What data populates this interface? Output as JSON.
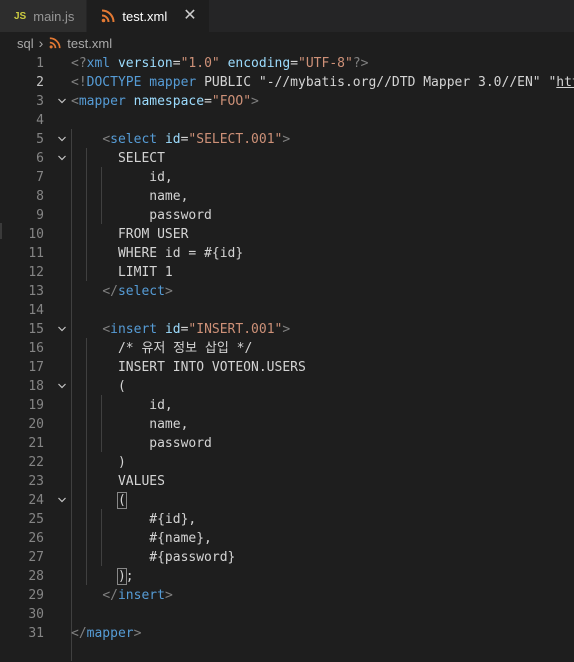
{
  "tabs": [
    {
      "label": "main.js",
      "icon": "js-icon",
      "badge": "JS",
      "active": false
    },
    {
      "label": "test.xml",
      "icon": "rss-icon",
      "active": true,
      "close": "✕"
    }
  ],
  "breadcrumb": {
    "folder": "sql",
    "separator": "›",
    "file": "test.xml"
  },
  "editor": {
    "lines": [
      {
        "n": "1",
        "tokens": [
          [
            "punct",
            "<?"
          ],
          [
            "tag",
            "xml"
          ],
          [
            "text",
            " "
          ],
          [
            "attr",
            "version"
          ],
          [
            "text",
            "="
          ],
          [
            "str",
            "\"1.0\""
          ],
          [
            "text",
            " "
          ],
          [
            "attr",
            "encoding"
          ],
          [
            "text",
            "="
          ],
          [
            "str",
            "\"UTF-8\""
          ],
          [
            "punct",
            "?>"
          ]
        ]
      },
      {
        "n": "2",
        "tokens": [
          [
            "punct",
            "<!"
          ],
          [
            "tag",
            "DOCTYPE"
          ],
          [
            "text",
            " "
          ],
          [
            "tag",
            "mapper"
          ],
          [
            "text",
            " PUBLIC "
          ],
          [
            "text",
            "\"-//mybatis.org//DTD Mapper 3.0//EN\""
          ],
          [
            "text",
            " \""
          ],
          [
            "url",
            "http"
          ]
        ]
      },
      {
        "n": "3",
        "tokens": [
          [
            "punct",
            "<"
          ],
          [
            "tag",
            "mapper"
          ],
          [
            "text",
            " "
          ],
          [
            "attr",
            "namespace"
          ],
          [
            "text",
            "="
          ],
          [
            "str",
            "\"FOO\""
          ],
          [
            "punct",
            ">"
          ]
        ]
      },
      {
        "n": "4",
        "tokens": []
      },
      {
        "n": "5",
        "tokens": [
          [
            "text",
            "    "
          ],
          [
            "punct",
            "<"
          ],
          [
            "tag",
            "select"
          ],
          [
            "text",
            " "
          ],
          [
            "attr",
            "id"
          ],
          [
            "text",
            "="
          ],
          [
            "str",
            "\"SELECT.001\""
          ],
          [
            "punct",
            ">"
          ]
        ]
      },
      {
        "n": "6",
        "tokens": [
          [
            "text",
            "      SELECT"
          ]
        ]
      },
      {
        "n": "7",
        "tokens": [
          [
            "text",
            "          id,"
          ]
        ]
      },
      {
        "n": "8",
        "tokens": [
          [
            "text",
            "          name,"
          ]
        ]
      },
      {
        "n": "9",
        "tokens": [
          [
            "text",
            "          password"
          ]
        ]
      },
      {
        "n": "10",
        "tokens": [
          [
            "text",
            "      FROM USER"
          ]
        ]
      },
      {
        "n": "11",
        "tokens": [
          [
            "text",
            "      WHERE id = #{id}"
          ]
        ]
      },
      {
        "n": "12",
        "tokens": [
          [
            "text",
            "      LIMIT 1"
          ]
        ]
      },
      {
        "n": "13",
        "tokens": [
          [
            "text",
            "    "
          ],
          [
            "punct",
            "</"
          ],
          [
            "tag",
            "select"
          ],
          [
            "punct",
            ">"
          ]
        ]
      },
      {
        "n": "14",
        "tokens": []
      },
      {
        "n": "15",
        "tokens": [
          [
            "text",
            "    "
          ],
          [
            "punct",
            "<"
          ],
          [
            "tag",
            "insert"
          ],
          [
            "text",
            " "
          ],
          [
            "attr",
            "id"
          ],
          [
            "text",
            "="
          ],
          [
            "str",
            "\"INSERT.001\""
          ],
          [
            "punct",
            ">"
          ]
        ]
      },
      {
        "n": "16",
        "tokens": [
          [
            "text",
            "      /* 유저 정보 삽입 */"
          ]
        ]
      },
      {
        "n": "17",
        "tokens": [
          [
            "text",
            "      INSERT INTO VOTEON.USERS"
          ]
        ]
      },
      {
        "n": "18",
        "tokens": [
          [
            "text",
            "      ("
          ]
        ]
      },
      {
        "n": "19",
        "tokens": [
          [
            "text",
            "          id,"
          ]
        ]
      },
      {
        "n": "20",
        "tokens": [
          [
            "text",
            "          name,"
          ]
        ]
      },
      {
        "n": "21",
        "tokens": [
          [
            "text",
            "          password"
          ]
        ]
      },
      {
        "n": "22",
        "tokens": [
          [
            "text",
            "      )"
          ]
        ]
      },
      {
        "n": "23",
        "tokens": [
          [
            "text",
            "      VALUES"
          ]
        ]
      },
      {
        "n": "24",
        "tokens": [
          [
            "text",
            "      "
          ],
          [
            "box",
            "("
          ]
        ]
      },
      {
        "n": "25",
        "tokens": [
          [
            "text",
            "          #{id},"
          ]
        ]
      },
      {
        "n": "26",
        "tokens": [
          [
            "text",
            "          #{name},"
          ]
        ]
      },
      {
        "n": "27",
        "tokens": [
          [
            "text",
            "          #{password}"
          ]
        ]
      },
      {
        "n": "28",
        "tokens": [
          [
            "text",
            "      "
          ],
          [
            "box",
            ")"
          ],
          [
            "text",
            ";"
          ]
        ]
      },
      {
        "n": "29",
        "tokens": [
          [
            "text",
            "    "
          ],
          [
            "punct",
            "</"
          ],
          [
            "tag",
            "insert"
          ],
          [
            "punct",
            ">"
          ]
        ]
      },
      {
        "n": "30",
        "tokens": []
      },
      {
        "n": "31",
        "tokens": [
          [
            "punct",
            "</"
          ],
          [
            "tag",
            "mapper"
          ],
          [
            "punct",
            ">"
          ]
        ]
      }
    ],
    "fold_lines": [
      "3",
      "5",
      "6",
      "15",
      "18",
      "24"
    ],
    "current_line": "2"
  },
  "colors": {
    "tag": "#569cd6",
    "attr": "#9cdcfe",
    "string": "#ce9178",
    "punct": "#808080",
    "text": "#d4d4d4"
  }
}
